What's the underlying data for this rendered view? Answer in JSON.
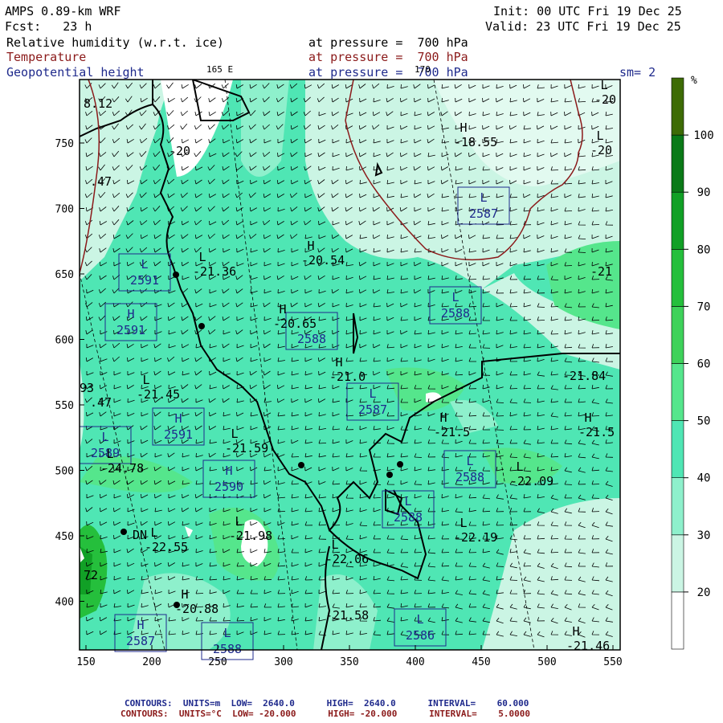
{
  "header": {
    "model": "AMPS 0.89-km WRF",
    "forecast": "Fcst:   23 h",
    "init": "Init: 00 UTC Fri 19 Dec 25",
    "valid": "Valid: 23 UTC Fri 19 Dec 25",
    "fields": [
      {
        "name": "Relative humidity (w.r.t. ice)",
        "level": "at pressure =  700 hPa",
        "color": "#000000"
      },
      {
        "name": "Temperature",
        "level": "at pressure =  700 hPa",
        "color": "#8b1a1a"
      },
      {
        "name": "Geopotential height",
        "level": "at pressure =  700 hPa",
        "color": "#1f2a8c"
      }
    ],
    "smoothing": "sm= 2",
    "lon_label_left": "165 E",
    "lon_label_right": "170"
  },
  "axes": {
    "x_ticks": [
      "150",
      "200",
      "250",
      "300",
      "350",
      "400",
      "450",
      "500",
      "550"
    ],
    "y_ticks": [
      "750",
      "700",
      "650",
      "600",
      "550",
      "500",
      "450",
      "400"
    ]
  },
  "colorbar": {
    "unit": "%",
    "labels": [
      "100",
      "90",
      "80",
      "70",
      "60",
      "50",
      "40",
      "30",
      "20"
    ],
    "colors": [
      "#ffffff",
      "#cbf5e4",
      "#8ef0cc",
      "#4fe6b4",
      "#55e68c",
      "#3ed25a",
      "#25bf3c",
      "#11a026",
      "#0a7a18",
      "#3d6b05"
    ]
  },
  "height_labels": [
    {
      "letter": "L",
      "value": "2591"
    },
    {
      "letter": "H",
      "value": "2591"
    },
    {
      "letter": "H",
      "value": "2591"
    },
    {
      "letter": "L",
      "value": "2589"
    },
    {
      "letter": "H",
      "value": "2590"
    },
    {
      "letter": "",
      "value": "2588"
    },
    {
      "letter": "L",
      "value": "2587"
    },
    {
      "letter": "L",
      "value": "2587"
    },
    {
      "letter": "L",
      "value": "2588"
    },
    {
      "letter": "L",
      "value": "2588"
    },
    {
      "letter": "L",
      "value": "2588"
    },
    {
      "letter": "L",
      "value": "2586"
    },
    {
      "letter": "H",
      "value": "2587"
    },
    {
      "letter": "L",
      "value": "2588"
    }
  ],
  "temp_labels": [
    {
      "letter": "",
      "value": "-20"
    },
    {
      "letter": "H",
      "value": "-18.55"
    },
    {
      "letter": "L",
      "value": "-20"
    },
    {
      "letter": "L",
      "value": "-20"
    },
    {
      "letter": "L",
      "value": "-21.36"
    },
    {
      "letter": "H",
      "value": "-20.54"
    },
    {
      "letter": "H",
      "value": "-20.65"
    },
    {
      "letter": "H",
      "value": "-21.0"
    },
    {
      "letter": "",
      "value": "-21.84"
    },
    {
      "letter": "L",
      "value": "-21.45"
    },
    {
      "letter": "H",
      "value": "-21.5"
    },
    {
      "letter": "H",
      "value": "-21.5"
    },
    {
      "letter": "L",
      "value": "-21.59"
    },
    {
      "letter": "L",
      "value": "-24.78"
    },
    {
      "letter": "L",
      "value": "-22.09"
    },
    {
      "letter": "L",
      "value": "-22.19"
    },
    {
      "letter": "L",
      "value": "-21.98"
    },
    {
      "letter": "L",
      "value": "-22.55"
    },
    {
      "letter": "L",
      "value": "-22.06"
    },
    {
      "letter": "H",
      "value": "-20.88"
    },
    {
      "letter": "",
      "value": "-21.58"
    },
    {
      "letter": "H",
      "value": "-21.46"
    },
    {
      "letter": "",
      "value": "-21"
    },
    {
      "letter": "",
      "value": "8.12"
    },
    {
      "letter": "",
      "value": ".47"
    },
    {
      "letter": "",
      "value": ".47"
    },
    {
      "letter": "",
      "value": "93"
    },
    {
      "letter": "",
      "value": "72"
    },
    {
      "letter": "",
      "value": "DN"
    }
  ],
  "footer": {
    "line1": "CONTOURS:  UNITS=m  LOW=  2640.0      HIGH=  2640.0      INTERVAL=    60.000",
    "line2": "CONTOURS:  UNITS=°C  LOW= -20.000      HIGH= -20.000      INTERVAL=    5.0000",
    "line1_color": "#1f2a8c",
    "line2_color": "#8b1a1a"
  }
}
